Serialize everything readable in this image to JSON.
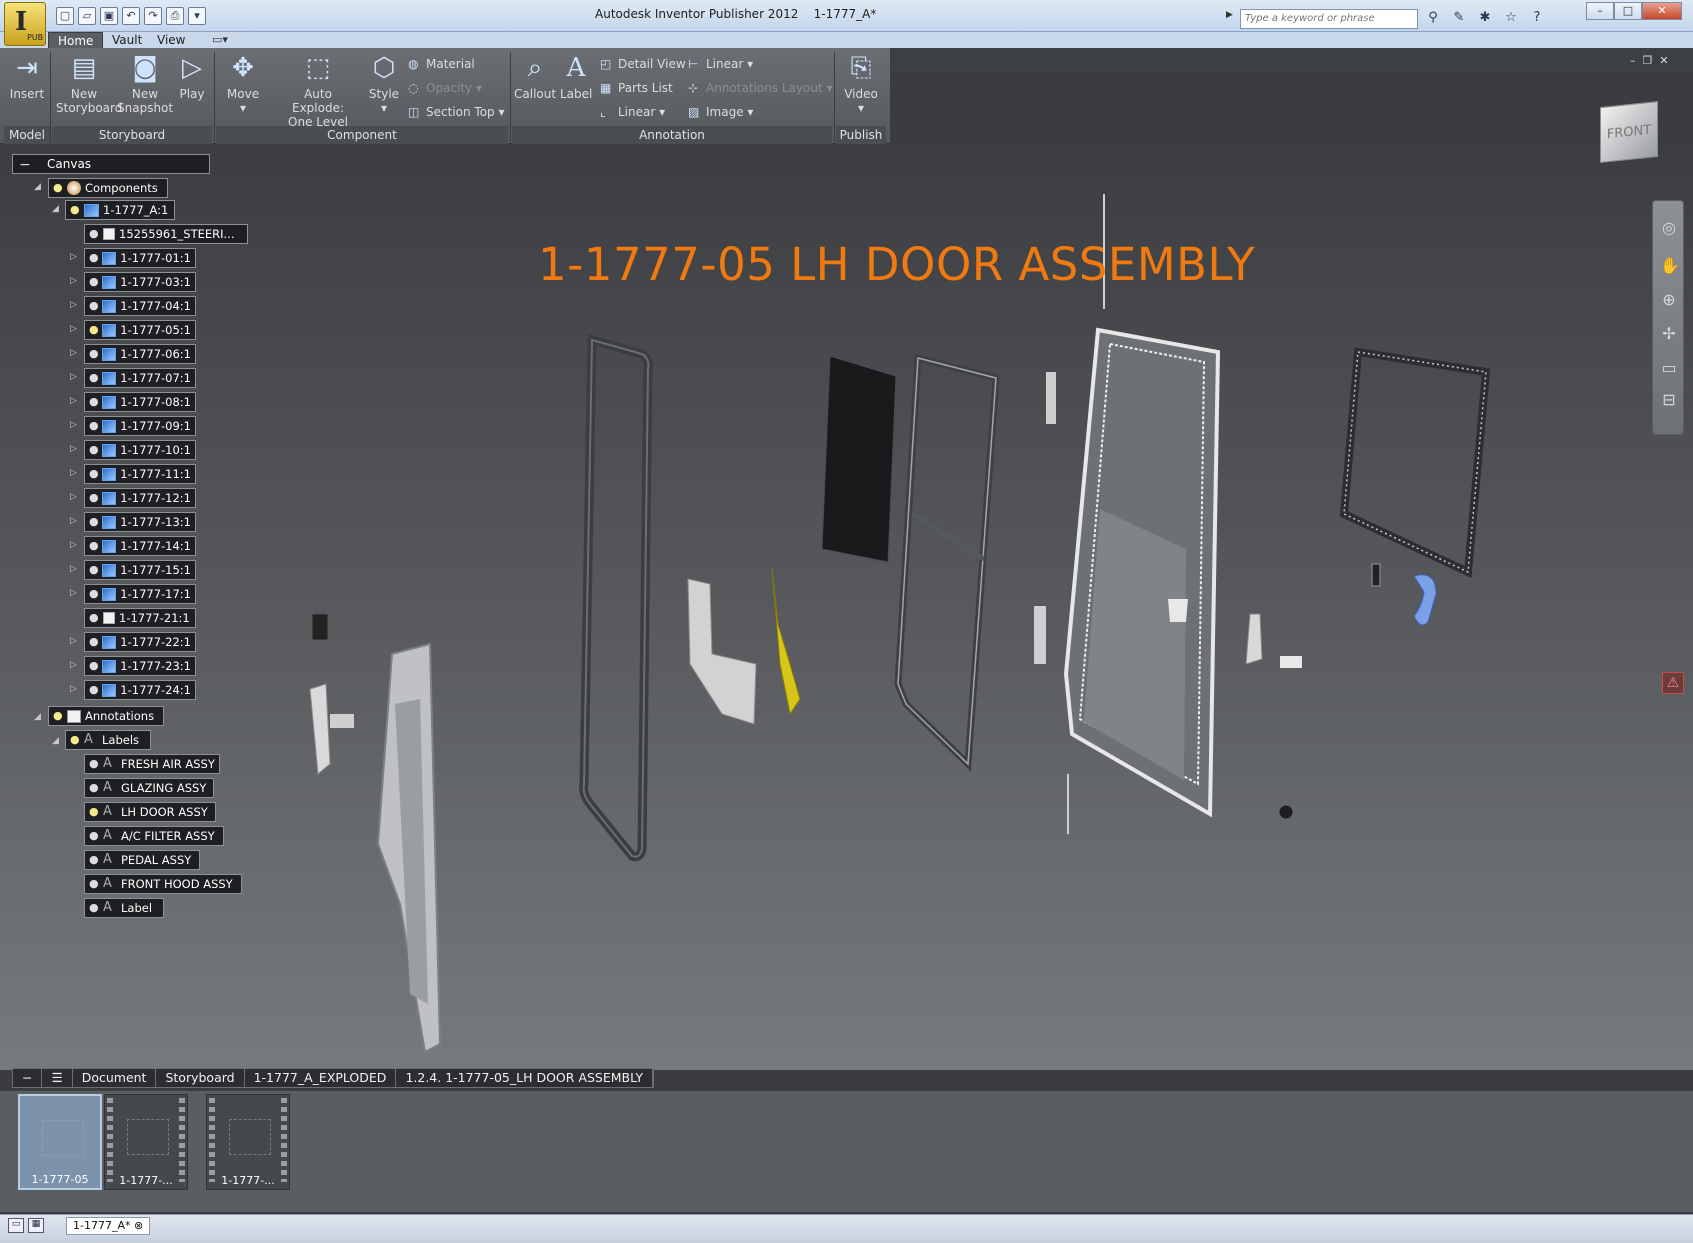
{
  "window": {
    "title": "Autodesk Inventor Publisher 2012",
    "document": "1-1777_A*",
    "search_placeholder": "Type a keyword or phrase",
    "app_badge": "PUB"
  },
  "menu_tabs": [
    "Home",
    "Vault",
    "View"
  ],
  "ribbon": {
    "buttons": {
      "insert": "Insert",
      "new_storyboard": "New Storyboard",
      "new_snapshot": "New Snapshot",
      "play": "Play",
      "move": "Move",
      "auto_explode": "Auto Explode: One Level",
      "style": "Style",
      "callout": "Callout",
      "label": "Label",
      "video": "Video"
    },
    "small": {
      "material": "Material",
      "opacity": "Opacity",
      "section_top": "Section Top",
      "detail_view": "Detail View",
      "parts_list": "Parts List",
      "linear_a": "Linear",
      "linear_b": "Linear",
      "annotations_layout": "Annotations Layout",
      "image": "Image"
    },
    "groups": {
      "model": "Model",
      "storyboard": "Storyboard",
      "component": "Component",
      "annotation": "Annotation",
      "publish": "Publish"
    }
  },
  "tree": {
    "root": "Canvas",
    "components": "Components",
    "assembly": "1-1777_A:1",
    "parts": [
      "15255961_STEERI...",
      "1-1777-01:1",
      "1-1777-03:1",
      "1-1777-04:1",
      "1-1777-05:1",
      "1-1777-06:1",
      "1-1777-07:1",
      "1-1777-08:1",
      "1-1777-09:1",
      "1-1777-10:1",
      "1-1777-11:1",
      "1-1777-12:1",
      "1-1777-13:1",
      "1-1777-14:1",
      "1-1777-15:1",
      "1-1777-17:1",
      "1-1777-21:1",
      "1-1777-22:1",
      "1-1777-23:1",
      "1-1777-24:1"
    ],
    "annotations": "Annotations",
    "labels": "Labels",
    "label_items": [
      "FRESH AIR ASSY",
      "GLAZING ASSY",
      "LH DOOR ASSY",
      "A/C FILTER ASSY",
      "PEDAL ASSY",
      "FRONT HOOD ASSY",
      "Label"
    ]
  },
  "scene": {
    "title": "1-1777-05 LH DOOR ASSEMBLY",
    "title_color": "#f07a10",
    "viewcube": "FRONT"
  },
  "breadcrumb": [
    "Document",
    "Storyboard",
    "1-1777_A_EXPLODED",
    "1.2.4. 1-1777-05_LH DOOR ASSEMBLY"
  ],
  "snapshots": [
    "1-1777-05",
    "1-1777-...",
    "1-1777-..."
  ],
  "status": {
    "doc_tab": "1-1777_A*"
  }
}
